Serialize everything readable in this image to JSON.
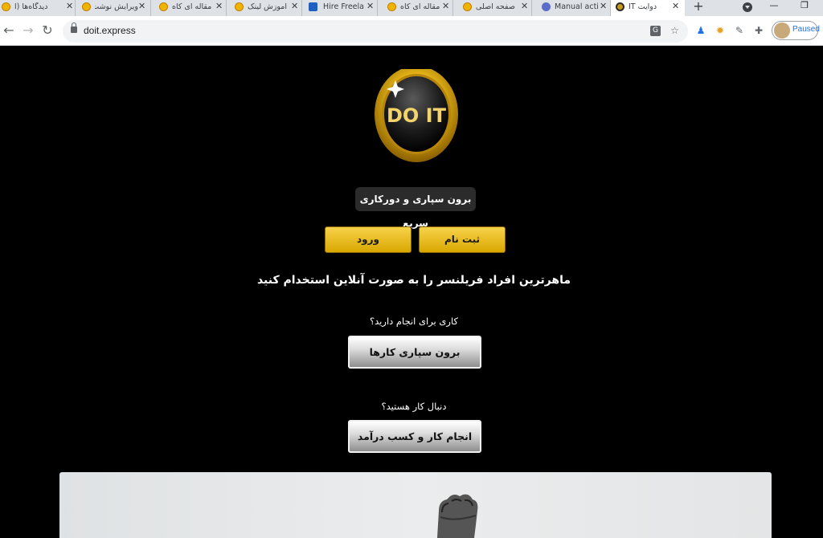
{
  "browser": {
    "tabs": [
      {
        "title": "دیدگاه‌ها (ا",
        "favicon": "yellow-ear-icon",
        "active": false
      },
      {
        "title": "ویرایش نوشت",
        "favicon": "yellow-ear-icon",
        "active": false
      },
      {
        "title": "مقاله ای کاه",
        "favicon": "yellow-ear-icon",
        "active": false
      },
      {
        "title": "آموزش لینک",
        "favicon": "yellow-ear-icon",
        "active": false
      },
      {
        "title": "Hire Freela",
        "favicon": "hire-icon",
        "active": false
      },
      {
        "title": "مقاله ای کاه",
        "favicon": "yellow-ear-icon",
        "active": false
      },
      {
        "title": "صفحه اصلی",
        "favicon": "yellow-ear-icon",
        "active": false
      },
      {
        "title": "Manual acti",
        "favicon": "manual-icon",
        "active": false
      },
      {
        "title": "دوآیت IT",
        "favicon": "doit-icon",
        "active": true
      }
    ],
    "new_tab_glyph": "+",
    "url": "doit.express",
    "profile_label": "Paused",
    "window_controls": [
      "—",
      "❐"
    ]
  },
  "page": {
    "logo_text": "DO IT",
    "tagline": "برون سپاری و دورکاری سریع",
    "signup_label": "ثبت نام",
    "login_label": "ورود",
    "headline": "ماهرترین افراد فریلنسر را به صورت آنلاین استخدام کنید",
    "q1": "کاری برای انجام دارید؟",
    "btn1": "برون سپاری کارها",
    "q2": "دنبال کار هستید؟",
    "btn2": "انجام کار و کسب درآمد"
  },
  "colors": {
    "background": "#000000",
    "gold": "#f2c21b",
    "silver": "#d6d6d6"
  }
}
